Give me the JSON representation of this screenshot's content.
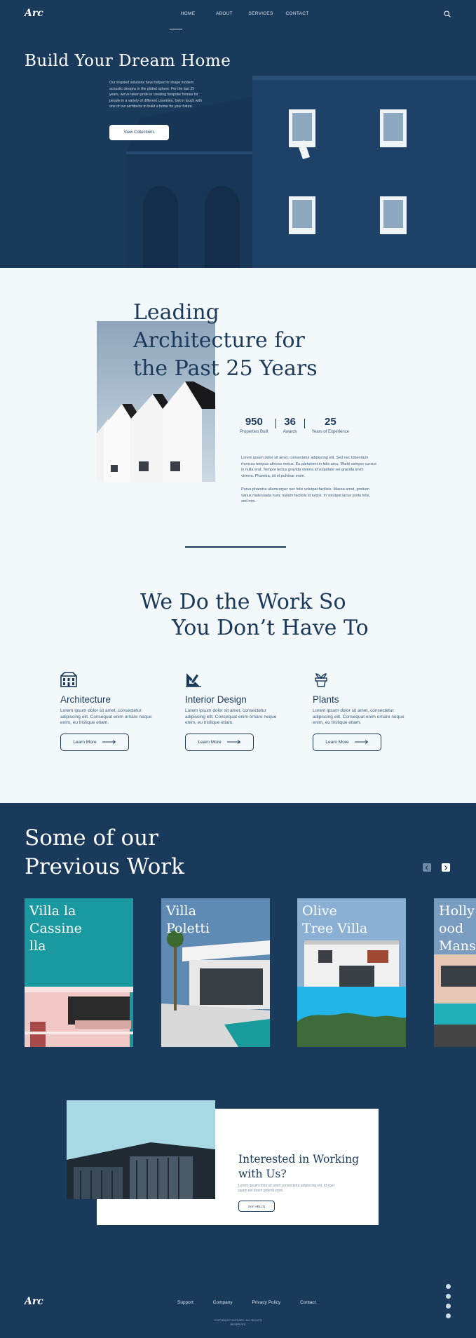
{
  "header": {
    "logo": "Arc",
    "nav": [
      "HOME",
      "ABOUT",
      "SERVICES",
      "CONTACT"
    ],
    "active_nav": "HOME",
    "search_icon": "search-icon"
  },
  "hero": {
    "title": "Build Your Dream Home",
    "text": "Our inspired solutions have helped to shape modern acoustic designs in the global sphere. For the last 25 years, we've taken pride in creating bespoke homes for people in a variety of different countries. Get in touch with one of our architects to build a home for your future.",
    "button": "View Collections"
  },
  "about": {
    "title_lines": [
      "Leading",
      "Architecture for",
      "the Past 25 Years"
    ],
    "stats": [
      {
        "value": "950",
        "label": "Properties Built"
      },
      {
        "value": "36",
        "label": "Awards"
      },
      {
        "value": "25",
        "label": "Years of Experience"
      }
    ],
    "paragraph1": "Lorem ipsum dolor sit amet, consectetur adipiscing elit. Sed nec bibendum rhoncus tempus ultrices metus. Eu parturient in felis arcu. Morbi semper cursus in nulla erat. Tempor lectus gravida viverra id vulputate vel gravida enim viverra. Pharetra, sit et pulvinar enim.",
    "paragraph2": "Purus pharetra ullamcorper nec felis volutpat facilisis. Massa amet, pretium varius malesuada nunc nullam facilisis id turpis. In volutpat lacus porta felis, sed non."
  },
  "services": {
    "title_lines": [
      "We Do the Work So",
      "You Don’t Have To"
    ],
    "items": [
      {
        "icon": "building-icon",
        "title": "Architecture",
        "text": "Lorem ipsum dolor sit amet, consectetur adipiscing elit. Consequat enim ornare neque enim, eu tristique etiam.",
        "button": "Learn More"
      },
      {
        "icon": "drafting-tools-icon",
        "title": "Interior Design",
        "text": "Lorem ipsum dolor sit amet, consectetur adipiscing elit. Consequat enim ornare neque enim, eu tristique etiam.",
        "button": "Learn More"
      },
      {
        "icon": "plant-pot-icon",
        "title": "Plants",
        "text": "Lorem ipsum dolor sit amet, consectetur adipiscing elit. Consequat enim ornare neque enim, eu tristique etiam.",
        "button": "Learn More"
      }
    ]
  },
  "work": {
    "title_lines": [
      "Some of our",
      "Previous Work"
    ],
    "cards": [
      {
        "title_lines": [
          "Villa la",
          "Cassine",
          "lla"
        ]
      },
      {
        "title_lines": [
          "Villa",
          "Poletti"
        ]
      },
      {
        "title_lines": [
          "Olive",
          "Tree Villa"
        ]
      },
      {
        "title_lines": [
          "Holly",
          "ood",
          "Mansi"
        ]
      }
    ]
  },
  "cta": {
    "title_lines": [
      "Interested in Working",
      "with Us?"
    ],
    "text": "Lorem ipsum dolor sit amet consectetur adipiscing elit. Id eget quam est lorem potenti enim.",
    "button": "SAY HELLO"
  },
  "footer": {
    "logo": "Arc",
    "links": [
      "Support",
      "Company",
      "Privacy Policy",
      "Contact"
    ],
    "copyright_lines": [
      "COPYRIGHT 2023 ARC. ALL RIGHTS",
      "RESERVED"
    ]
  },
  "colors": {
    "primary": "#1a3a5c",
    "light_bg": "#f3f8fa",
    "white": "#ffffff"
  }
}
